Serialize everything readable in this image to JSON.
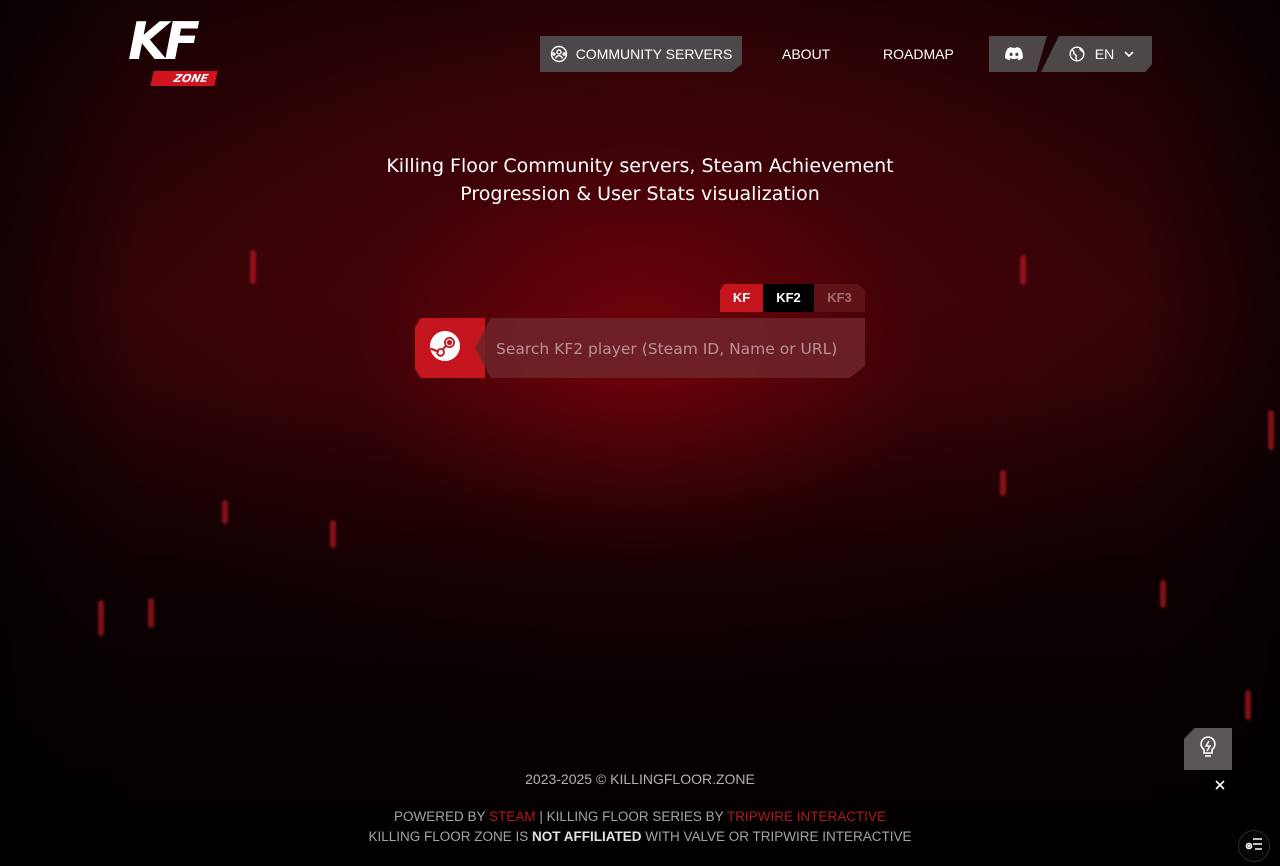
{
  "header": {
    "logo": {
      "main": "KF",
      "sub": "ZONE"
    },
    "nav": {
      "community_servers": "COMMUNITY SERVERS",
      "about": "ABOUT",
      "roadmap": "ROADMAP",
      "language": "EN"
    },
    "icons": {
      "community": "community-servers-icon",
      "discord": "discord-icon",
      "globe": "globe-icon",
      "chevron": "chevron-down-icon"
    }
  },
  "hero": {
    "line1": "Killing Floor Community servers, Steam Achievement",
    "line2": "Progression & User Stats visualization"
  },
  "game_tabs": [
    {
      "label": "KF",
      "state": "inactive"
    },
    {
      "label": "KF2",
      "state": "selected"
    },
    {
      "label": "KF3",
      "state": "disabled"
    }
  ],
  "search": {
    "icon": "steam-icon",
    "placeholder": "Search KF2 player (Steam ID, Name or URL)",
    "value": ""
  },
  "footer": {
    "copyright": "2023-2025 © KILLINGFLOOR.ZONE",
    "powered_by": "POWERED BY",
    "steam": "STEAM",
    "series_by": "| KILLING FLOOR SERIES BY",
    "tripwire": "TRIPWIRE INTERACTIVE",
    "disclaimer_pre": "KILLING FLOOR ZONE IS",
    "not_affiliated": "NOT AFFILIATED",
    "disclaimer_post": "WITH VALVE OR TRIPWIRE INTERACTIVE"
  },
  "floating": {
    "idea_icon": "lightbulb-icon",
    "close_icon": "close-icon",
    "settings_icon": "settings-list-icon"
  },
  "colors": {
    "accent": "#c4141d",
    "nav_bg": "#4e474a",
    "background": "#1a0204"
  }
}
